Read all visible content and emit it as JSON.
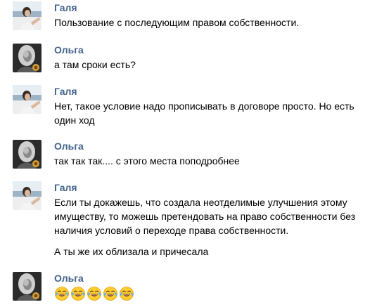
{
  "messages": [
    {
      "author": "Галя",
      "paragraphs": [
        "Пользование с последующим правом собственности."
      ]
    },
    {
      "author": "Ольга",
      "paragraphs": [
        "а там сроки есть?"
      ]
    },
    {
      "author": "Галя",
      "paragraphs": [
        "Нет, такое условие надо прописывать в договоре просто. Но есть один ход"
      ]
    },
    {
      "author": "Ольга",
      "paragraphs": [
        "так так так.... с этого места поподробнее"
      ]
    },
    {
      "author": "Галя",
      "paragraphs": [
        "Если ты докажешь, что создала неотделимые улучшения этому имуществу, то можешь претендовать на право собственности без наличия условий о переходе права собственности.",
        "А ты же их облизала и причесала"
      ]
    },
    {
      "author": "Ольга",
      "emojis": [
        "tears-of-joy-icon",
        "tears-of-joy-icon",
        "tears-of-joy-icon",
        "tears-of-joy-icon",
        "tears-of-joy-icon"
      ]
    }
  ],
  "colors": {
    "author_link": "#42648b",
    "text": "#000000",
    "background": "#ffffff"
  }
}
